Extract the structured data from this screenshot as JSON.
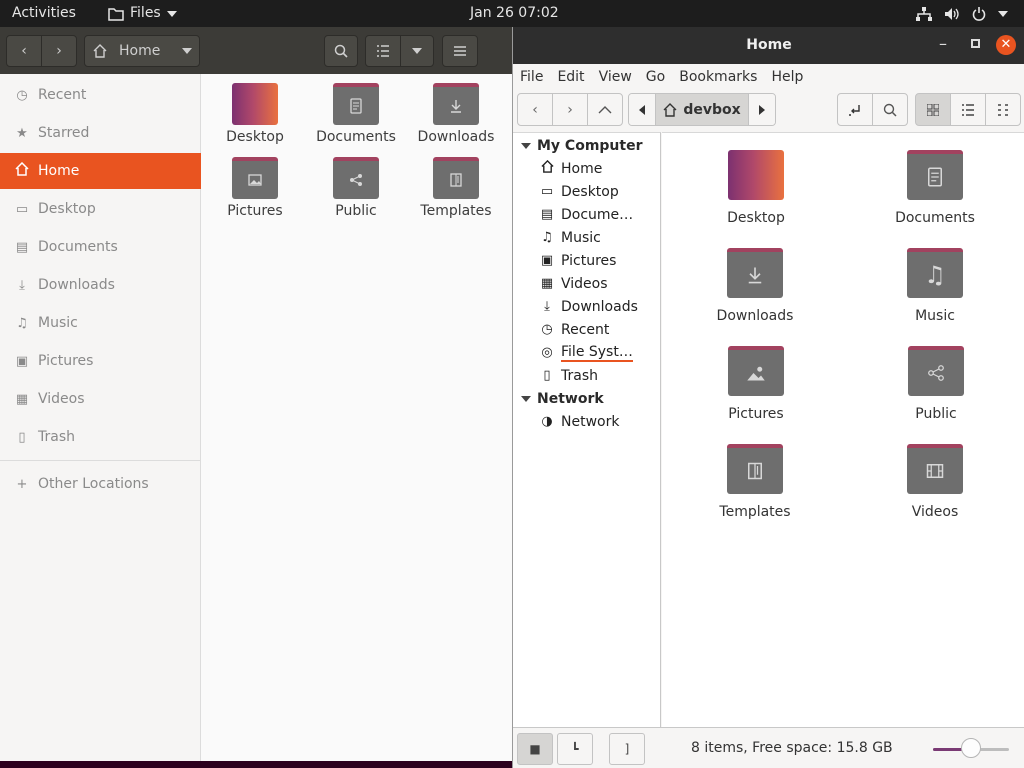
{
  "topbar": {
    "activities": "Activities",
    "app_menu": "Files",
    "clock": "Jan 26  07:02"
  },
  "left_window": {
    "location": "Home",
    "sidebar": [
      {
        "label": "Recent",
        "icon": "clock-icon"
      },
      {
        "label": "Starred",
        "icon": "star-icon"
      },
      {
        "label": "Home",
        "icon": "home-icon",
        "active": true
      },
      {
        "label": "Desktop",
        "icon": "desktop-icon"
      },
      {
        "label": "Documents",
        "icon": "document-icon"
      },
      {
        "label": "Downloads",
        "icon": "download-icon"
      },
      {
        "label": "Music",
        "icon": "music-icon"
      },
      {
        "label": "Pictures",
        "icon": "picture-icon"
      },
      {
        "label": "Videos",
        "icon": "video-icon"
      },
      {
        "label": "Trash",
        "icon": "trash-icon"
      },
      {
        "label": "Other Locations",
        "icon": "plus-icon"
      }
    ],
    "items": [
      "Desktop",
      "Documents",
      "Downloads",
      "Pictures",
      "Public",
      "Templates"
    ]
  },
  "right_window": {
    "title": "Home",
    "menu": [
      "File",
      "Edit",
      "View",
      "Go",
      "Bookmarks",
      "Help"
    ],
    "path_current": "devbox",
    "tree": {
      "my_computer": "My Computer",
      "computer_items": [
        {
          "label": "Home",
          "icon": "home-icon"
        },
        {
          "label": "Desktop",
          "icon": "desktop-icon"
        },
        {
          "label": "Docume…",
          "icon": "document-icon"
        },
        {
          "label": "Music",
          "icon": "music-icon"
        },
        {
          "label": "Pictures",
          "icon": "picture-icon"
        },
        {
          "label": "Videos",
          "icon": "video-icon"
        },
        {
          "label": "Downloads",
          "icon": "download-icon"
        },
        {
          "label": "Recent",
          "icon": "clock-icon"
        },
        {
          "label": "File Syst…",
          "icon": "disk-icon"
        },
        {
          "label": "Trash",
          "icon": "trash-icon"
        }
      ],
      "network": "Network",
      "network_items": [
        {
          "label": "Network",
          "icon": "globe-icon"
        }
      ]
    },
    "items": [
      "Desktop",
      "Documents",
      "Downloads",
      "Music",
      "Pictures",
      "Public",
      "Templates",
      "Videos"
    ],
    "status": "8 items, Free space: 15.8 GB",
    "zoom_level": 0.5
  },
  "colors": {
    "accent": "#e95420",
    "folder_tab": "#a2425f",
    "folder_body": "#6e6e6e"
  }
}
